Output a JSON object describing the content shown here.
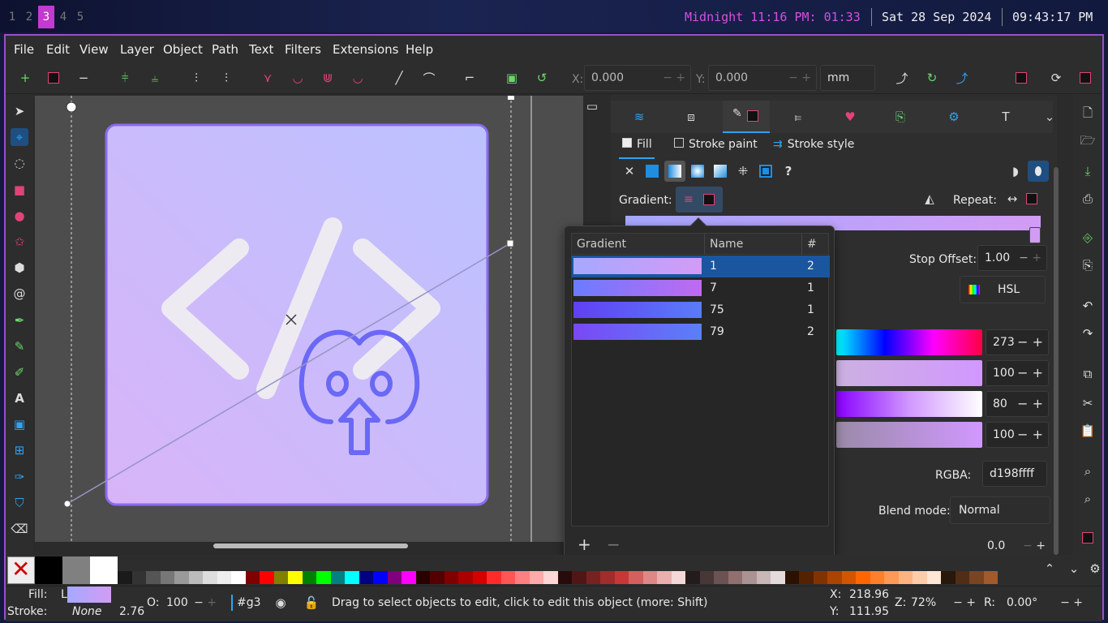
{
  "topbar": {
    "workspaces": [
      "1",
      "2",
      "3",
      "4",
      "5"
    ],
    "active_workspace": "3",
    "midnight": "Midnight 11:16 PM: 01:33",
    "date": "Sat 28 Sep 2024",
    "time": "09:43:17 PM"
  },
  "menu": [
    "File",
    "Edit",
    "View",
    "Layer",
    "Object",
    "Path",
    "Text",
    "Filters",
    "Extensions",
    "Help"
  ],
  "cmdbar": {
    "x_label": "X:",
    "x_value": "0.000",
    "y_label": "Y:",
    "y_value": "0.000",
    "unit": "mm"
  },
  "fill_stroke": {
    "tabs": [
      "Fill",
      "Stroke paint",
      "Stroke style"
    ],
    "gradient_label": "Gradient:",
    "repeat_label": "Repeat:",
    "stop_offset_label": "Stop Offset:",
    "stop_offset_value": "1.00",
    "color_mode": "HSL",
    "hue": "273",
    "saturation": "100",
    "lightness": "80",
    "alpha": "100",
    "rgba_label": "RGBA:",
    "rgba_value": "d198ffff",
    "blend_label": "Blend mode:",
    "blend_value": "Normal",
    "blur_value": "0.0"
  },
  "gradient_popup": {
    "headers": [
      "Gradient",
      "Name",
      "#"
    ],
    "rows": [
      {
        "name": "1",
        "count": "2",
        "c1": "#a6a8ff",
        "c2": "#d29cf5"
      },
      {
        "name": "7",
        "count": "1",
        "c1": "#6b7cff",
        "c2": "#c06af0"
      },
      {
        "name": "75",
        "count": "1",
        "c1": "#6040f5",
        "c2": "#5a7cf8"
      },
      {
        "name": "79",
        "count": "2",
        "c1": "#7a48f5",
        "c2": "#5a80f8"
      }
    ],
    "add": "+",
    "remove": "−"
  },
  "status": {
    "fill_label": "Fill:",
    "fill_letter": "L",
    "stroke_label": "Stroke:",
    "stroke_value": "None",
    "stroke_width": "2.76",
    "opacity_label": "O:",
    "opacity_value": "100",
    "layer": "#g3",
    "message": "Drag to select objects to edit, click to edit this object (more: Shift)",
    "cx_label": "X:",
    "cx": "218.96",
    "cy_label": "Y:",
    "cy": "111.95",
    "zoom_label": "Z:",
    "zoom": "72%",
    "rot_label": "R:",
    "rot": "0.00°"
  }
}
